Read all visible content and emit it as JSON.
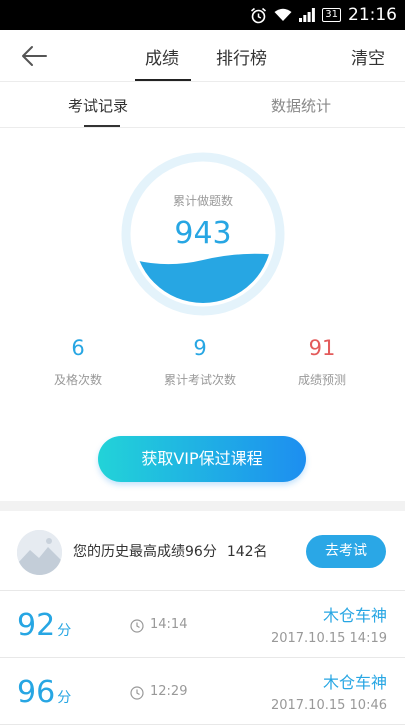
{
  "status": {
    "calendar": "31",
    "time": "21:16"
  },
  "nav": {
    "tabs": [
      "成绩",
      "排行榜"
    ],
    "clear": "清空"
  },
  "subtabs": [
    "考试记录",
    "数据统计"
  ],
  "gauge": {
    "label": "累计做题数",
    "value": "943"
  },
  "stats": [
    {
      "value": "6",
      "label": "及格次数"
    },
    {
      "value": "9",
      "label": "累计考试次数"
    },
    {
      "value": "91",
      "label": "成绩预测"
    }
  ],
  "vip_button": "获取VIP保过课程",
  "best": {
    "text": "您的历史最高成绩96分",
    "rank": "142名",
    "button": "去考试"
  },
  "records": [
    {
      "score": "92",
      "unit": "分",
      "duration": "14:14",
      "name": "木仓车神",
      "date": "2017.10.15  14:19"
    },
    {
      "score": "96",
      "unit": "分",
      "duration": "12:29",
      "name": "木仓车神",
      "date": "2017.10.15  10:46"
    }
  ],
  "colors": {
    "accent": "#27a6e3",
    "prediction": "#e35b5b",
    "vip_gradient": [
      "#22d3d8",
      "#1d8ef0"
    ]
  }
}
